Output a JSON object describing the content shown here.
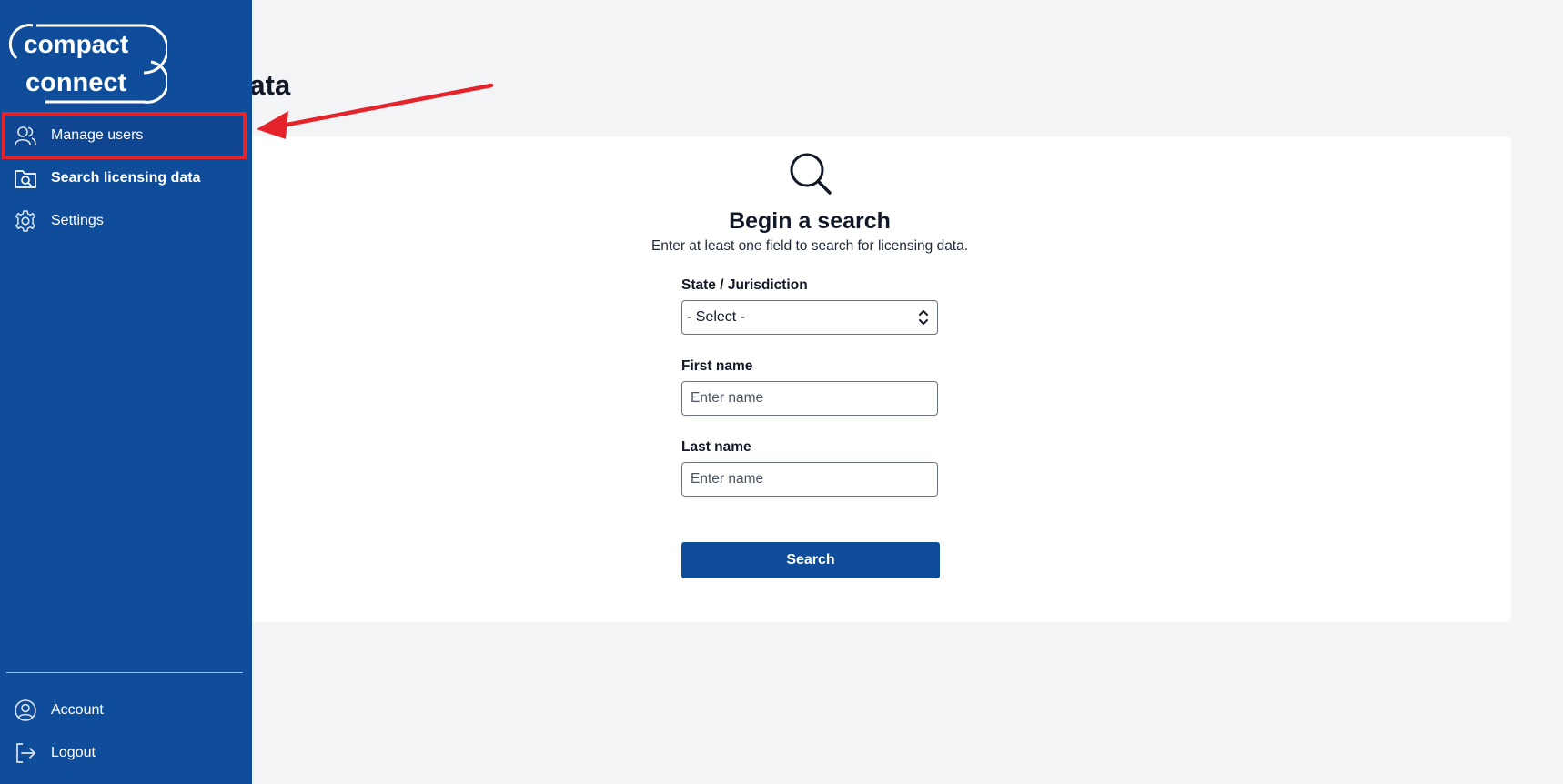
{
  "page": {
    "title_partial": "Data"
  },
  "sidebar": {
    "logo_line1": "compact",
    "logo_line2": "connect",
    "nav": [
      {
        "label": "Manage users",
        "icon": "users-icon",
        "highlighted": true
      },
      {
        "label": "Search licensing data",
        "icon": "folder-search-icon",
        "active": true
      },
      {
        "label": "Settings",
        "icon": "gear-icon"
      }
    ],
    "bottom": [
      {
        "label": "Account",
        "icon": "account-circle-icon"
      },
      {
        "label": "Logout",
        "icon": "logout-icon"
      }
    ]
  },
  "search_card": {
    "icon": "magnifier-icon",
    "heading": "Begin a search",
    "subheading": "Enter at least one field to search for licensing data.",
    "state_label": "State / Jurisdiction",
    "state_value": "- Select -",
    "first_name_label": "First name",
    "first_name_placeholder": "Enter name",
    "last_name_label": "Last name",
    "last_name_placeholder": "Enter name",
    "search_button": "Search"
  },
  "colors": {
    "sidebar": "#0f4c99",
    "primary_button": "#0f4c99",
    "annotation_red": "#e5232a",
    "background": "#f3f4f6"
  }
}
